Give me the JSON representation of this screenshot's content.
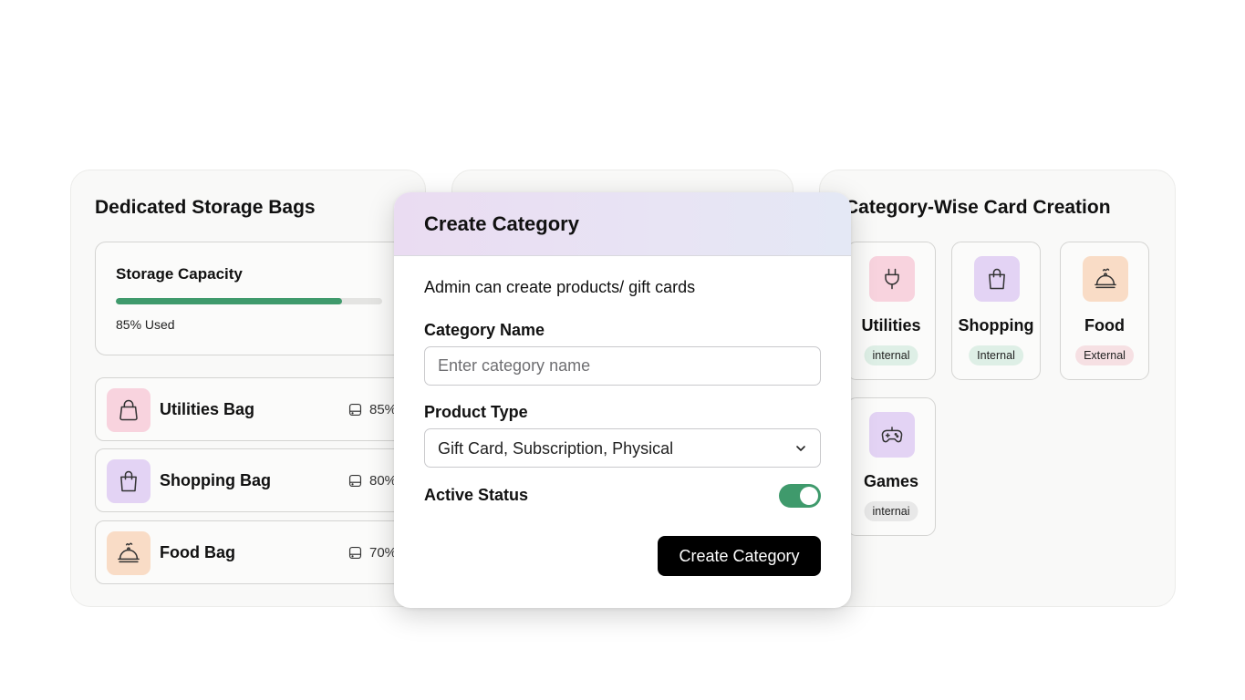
{
  "left_panel": {
    "title": "Dedicated Storage Bags",
    "storage": {
      "label": "Storage Capacity",
      "used_text": "85% Used",
      "used_fraction": 0.85
    },
    "bags": [
      {
        "name": "Utilities Bag",
        "percent": "85%",
        "icon": "bag-icon",
        "color": "#f8d3de"
      },
      {
        "name": "Shopping Bag",
        "percent": "80%",
        "icon": "shopping-bag-icon",
        "color": "#e3d3f4"
      },
      {
        "name": "Food Bag",
        "percent": "70%",
        "icon": "food-cloche-icon",
        "color": "#f9dcc6"
      }
    ]
  },
  "right_panel": {
    "title": "Category-Wise Card Creation",
    "categories": [
      {
        "name": "Utilities",
        "tag": "internal",
        "icon": "plug-icon",
        "color": "#f8d3de",
        "tag_color": "#deefe6"
      },
      {
        "name": "Shopping",
        "tag": "Internal",
        "icon": "shopping-bag-icon",
        "color": "#e3d3f4",
        "tag_color": "#deefe6"
      },
      {
        "name": "Food",
        "tag": "External",
        "icon": "food-cloche-icon",
        "color": "#f9dcc6",
        "tag_color": "#f6e0e3"
      },
      {
        "name": "Games",
        "tag": "internai",
        "icon": "gamepad-icon",
        "color": "#e3d3f4",
        "tag_color": "#e8e8e8"
      }
    ]
  },
  "modal": {
    "title": "Create Category",
    "subtitle": "Admin can create products/ gift cards",
    "category_name_label": "Category Name",
    "category_name_placeholder": "Enter category name",
    "product_type_label": "Product Type",
    "product_type_value": "Gift Card, Subscription, Physical",
    "active_status_label": "Active Status",
    "active_status_on": true,
    "submit_label": "Create Category"
  },
  "colors": {
    "accent_green": "#3f9a6c",
    "button_black": "#000000"
  }
}
